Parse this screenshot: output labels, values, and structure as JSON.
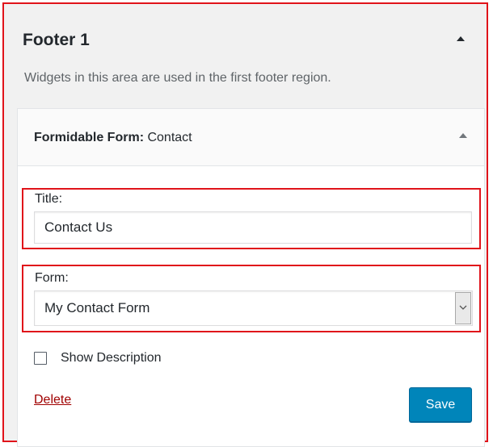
{
  "sidebar": {
    "title": "Footer 1",
    "description": "Widgets in this area are used in the first footer region."
  },
  "widget": {
    "type_label": "Formidable Form",
    "separator": ":",
    "instance_title": " Contact",
    "fields": {
      "title_label": "Title:",
      "title_value": "Contact Us",
      "form_label": "Form:",
      "form_selected": "My Contact Form",
      "show_description_label": "Show Description",
      "show_description_checked": false
    },
    "actions": {
      "delete_label": "Delete",
      "save_label": "Save"
    }
  },
  "colors": {
    "highlight": "#e0131a",
    "primary_button": "#0085ba",
    "delete_link": "#a00000",
    "panel_background": "#f1f1f1"
  },
  "icons": {
    "area_toggle": "triangle-up-icon",
    "widget_toggle": "triangle-up-icon",
    "select_arrow": "chevron-down-icon"
  }
}
